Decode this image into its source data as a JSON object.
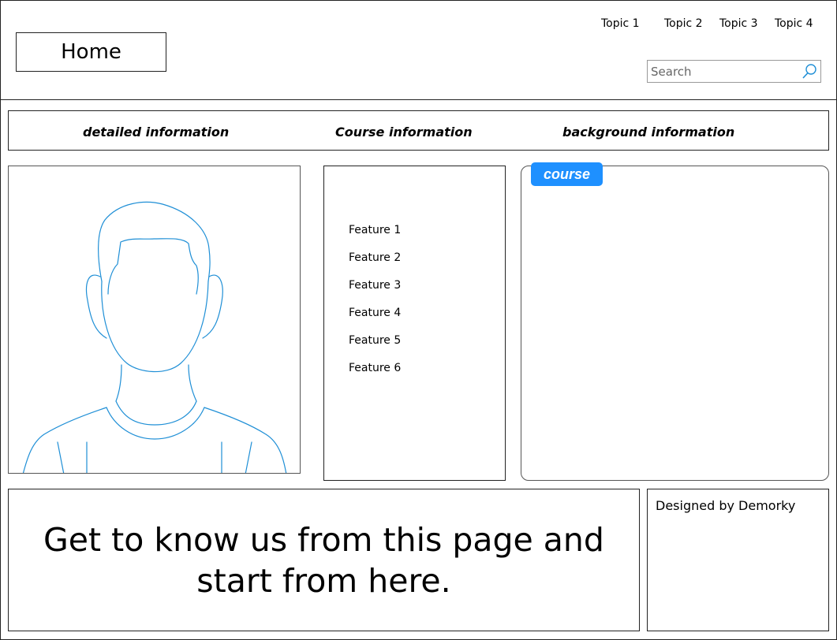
{
  "header": {
    "home_label": "Home",
    "topics": [
      "Topic 1",
      "Topic 2",
      "Topic 3",
      "Topic 4"
    ],
    "search": {
      "placeholder": "Search",
      "value": "",
      "icon": "search-icon"
    }
  },
  "tabs": [
    {
      "label": "detailed information"
    },
    {
      "label": "Course information"
    },
    {
      "label": "background information"
    }
  ],
  "avatar": {
    "icon": "person-avatar-icon",
    "stroke_color": "#1f8fd6"
  },
  "features": [
    "Feature 1",
    "Feature 2",
    "Feature 3",
    "Feature 4",
    "Feature 5",
    "Feature 6"
  ],
  "course_panel": {
    "badge_label": "course",
    "badge_color": "#1e90ff"
  },
  "footer": {
    "tagline": "Get to know us from this page and start from here.",
    "credit": "Designed by Demorky"
  }
}
